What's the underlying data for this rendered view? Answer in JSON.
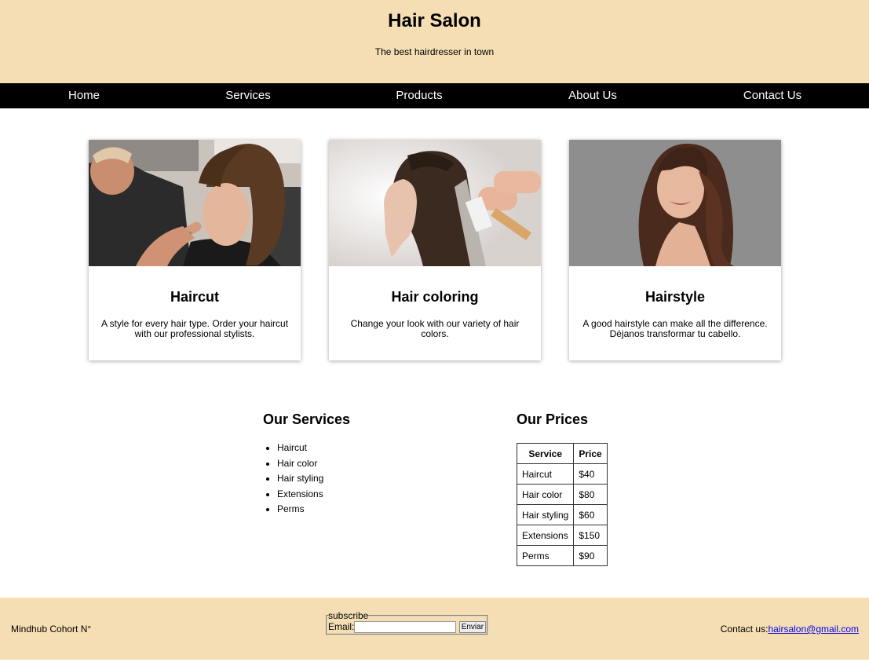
{
  "header": {
    "title": "Hair Salon",
    "tagline": "The best hairdresser in town"
  },
  "nav": {
    "items": [
      "Home",
      "Services",
      "Products",
      "About Us",
      "Contact Us"
    ]
  },
  "cards": [
    {
      "title": "Haircut",
      "text": "A style for every hair type. Order your haircut with our professional stylists."
    },
    {
      "title": "Hair coloring",
      "text": "Change your look with our variety of hair colors."
    },
    {
      "title": "Hairstyle",
      "text": "A good hairstyle can make all the difference. Déjanos transformar tu cabello."
    }
  ],
  "services": {
    "title": "Our Services",
    "items": [
      "Haircut",
      "Hair color",
      "Hair styling",
      "Extensions",
      "Perms"
    ]
  },
  "prices": {
    "title": "Our Prices",
    "headers": [
      "Service",
      "Price"
    ],
    "rows": [
      [
        "Haircut",
        "$40"
      ],
      [
        "Hair color",
        "$80"
      ],
      [
        "Hair styling",
        "$60"
      ],
      [
        "Extensions",
        "$150"
      ],
      [
        "Perms",
        "$90"
      ]
    ]
  },
  "footer": {
    "left": "Mindhub Cohort N°",
    "subscribe_legend": "subscribe",
    "email_label": "Email:",
    "email_value": "",
    "submit_label": "Enviar",
    "contact_label": "Contact us:",
    "contact_email": "hairsalon@gmail.com"
  },
  "colors": {
    "header_bg": "#f5deb3",
    "nav_bg": "#000000",
    "link": "#0000ee"
  }
}
